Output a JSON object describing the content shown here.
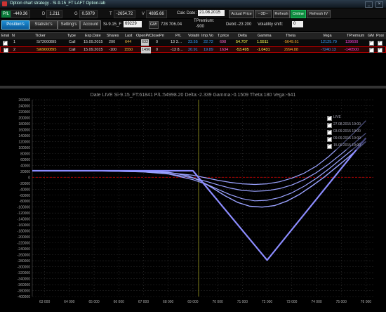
{
  "window": {
    "title": "Option chart strategy - Si-9.15_FT LAFT Option-lab"
  },
  "stats": {
    "pl_label": "P/L",
    "pl_value": "-449.36",
    "d_label": "D",
    "d_value": "1.211",
    "g_label": "G",
    "g_value": "0.5079",
    "t_label": "T",
    "t_value": "-2654.72",
    "v_label": "V",
    "v_value": "4885.66",
    "calc_date_label": "Calc Date:",
    "calc_date_value": "21.08.2015",
    "actual_price": "Actual Price",
    "nav": "--3D--",
    "refresh": "Refresh",
    "online": "Online",
    "refresh_iv": "Refresh IV"
  },
  "tabs": [
    "Position's",
    "Statistic's",
    "Setting's",
    "Account"
  ],
  "instrument": {
    "symbol": "Si-9.15_F",
    "price": "69229",
    "gm_label": "GM:",
    "gm_value": "728 706.04",
    "tpremium_label": "TPremium:",
    "tpremium_value": "-900",
    "debit_label": "Debit:",
    "debit_value": "-23 200",
    "vol_shift_label": "Volatility shift:",
    "vol_shift_value": "0"
  },
  "table": {
    "headers": [
      "Enal",
      "N",
      "Ticker",
      "Type",
      "Exp.Date",
      "Shares",
      "Last",
      "OpenPri",
      "ClosePri",
      "P/L",
      "Volatili",
      "Imp.Vo",
      "T.price",
      "Delta",
      "Gamma",
      "Theta",
      "Vega",
      "TPremium",
      "GM",
      "Posi"
    ],
    "rows": [
      [
        "",
        "1",
        "Si72000BI5",
        "Call",
        "15.09.2015",
        "200",
        "644",
        "632",
        "0",
        "13 3…",
        "23.55",
        "22.72",
        "698",
        "54.707",
        "1.5511",
        "-5649.61",
        "12125.79",
        "139600",
        "",
        ""
      ],
      [
        "",
        "2",
        "Si69000BI5",
        "Call",
        "15.09.2015",
        "-100",
        "1550",
        "1496",
        "0",
        "-13 8…",
        "20.91",
        "19.89",
        "1634",
        "-53.495",
        "-1.0431",
        "2994.88",
        "-7240.13",
        "-140500",
        "",
        ""
      ]
    ]
  },
  "chart_data": {
    "type": "line",
    "title": "Date LIVE  Si-9.15_FT:61841  P/L:54998.20  Delta:-2.339  Gamma:-0.1509  Theta:180  Vega:-641",
    "xlim": [
      62500,
      76300
    ],
    "ylim": [
      -400000,
      260000
    ],
    "x_ticks": [
      63000,
      64000,
      65000,
      66000,
      67000,
      68000,
      69000,
      70000,
      71000,
      72000,
      73000,
      74000,
      75000,
      76000
    ],
    "x_tick_labels": [
      "63 000",
      "64 000",
      "65 000",
      "66 000",
      "67 000",
      "68 000",
      "69 000",
      "70 000",
      "71 000",
      "72 000",
      "73 000",
      "74 000",
      "75 000",
      "76 000"
    ],
    "y_ticks": [
      260000,
      240000,
      220000,
      200000,
      180000,
      160000,
      140000,
      120000,
      100000,
      80000,
      60000,
      40000,
      20000,
      0,
      -20000,
      -40000,
      -60000,
      -80000,
      -100000,
      -120000,
      -140000,
      -160000,
      -180000,
      -200000,
      -220000,
      -240000,
      -260000,
      -280000,
      -300000,
      -320000,
      -340000,
      -360000,
      -380000,
      -400000
    ],
    "current_price": 69229,
    "zero_line": 0,
    "series": [
      {
        "name": "LIVE",
        "color": "#9aa2ff",
        "width": 1.2,
        "x": [
          62500,
          65000,
          67000,
          68000,
          69000,
          69600,
          70000,
          70500,
          71000,
          71500,
          72000,
          72500,
          73000,
          73500,
          74000,
          74500,
          75000,
          75500,
          76000
        ],
        "y": [
          22000,
          21500,
          19000,
          15000,
          7000,
          -3000,
          -10000,
          -17000,
          -22000,
          -24000,
          -22000,
          -15000,
          -3000,
          14000,
          38000,
          70000,
          108000,
          148000,
          190000
        ]
      },
      {
        "name": "27.08.2015 19:00",
        "color": "#9aa2ff",
        "width": 1.2,
        "x": [
          62500,
          65000,
          67000,
          68000,
          69000,
          69600,
          70000,
          70500,
          71000,
          71500,
          72000,
          72500,
          73000,
          73500,
          74000,
          74500,
          75000,
          75500,
          76000
        ],
        "y": [
          22000,
          21500,
          18000,
          12000,
          -2000,
          -15000,
          -25000,
          -36000,
          -44000,
          -47000,
          -45000,
          -38000,
          -26000,
          -8000,
          16000,
          45000,
          78000,
          113000,
          148000
        ]
      },
      {
        "name": "03.09.2015 19:00",
        "color": "#9aa2ff",
        "width": 1.2,
        "x": [
          62500,
          65000,
          67000,
          68000,
          69000,
          69600,
          70000,
          70500,
          71000,
          71500,
          72000,
          72500,
          73000,
          73500,
          74000,
          74500,
          75000,
          75500,
          76000
        ],
        "y": [
          22000,
          21500,
          18000,
          11000,
          -8000,
          -25000,
          -40000,
          -58000,
          -72000,
          -79000,
          -77000,
          -68000,
          -52000,
          -30000,
          -3000,
          28000,
          62000,
          96000,
          130000
        ]
      },
      {
        "name": "09.09.2015 19:00",
        "color": "#9aa2ff",
        "width": 1.4,
        "x": [
          62500,
          65000,
          67000,
          68000,
          68800,
          69300,
          69800,
          70300,
          70800,
          71300,
          71800,
          72300,
          72800,
          73300,
          73800,
          74300,
          74800,
          75300,
          76000
        ],
        "y": [
          22000,
          22000,
          21000,
          17000,
          5000,
          -12000,
          -36000,
          -62000,
          -84000,
          -97000,
          -100000,
          -95000,
          -80000,
          -58000,
          -30000,
          0,
          34000,
          68000,
          120000
        ]
      },
      {
        "name": "15.09.2015 19:00",
        "color": "#8c8cff",
        "width": 2.2,
        "x": [
          62500,
          69000,
          72000,
          76000
        ],
        "y": [
          22000,
          22000,
          -278000,
          132000
        ]
      }
    ]
  }
}
